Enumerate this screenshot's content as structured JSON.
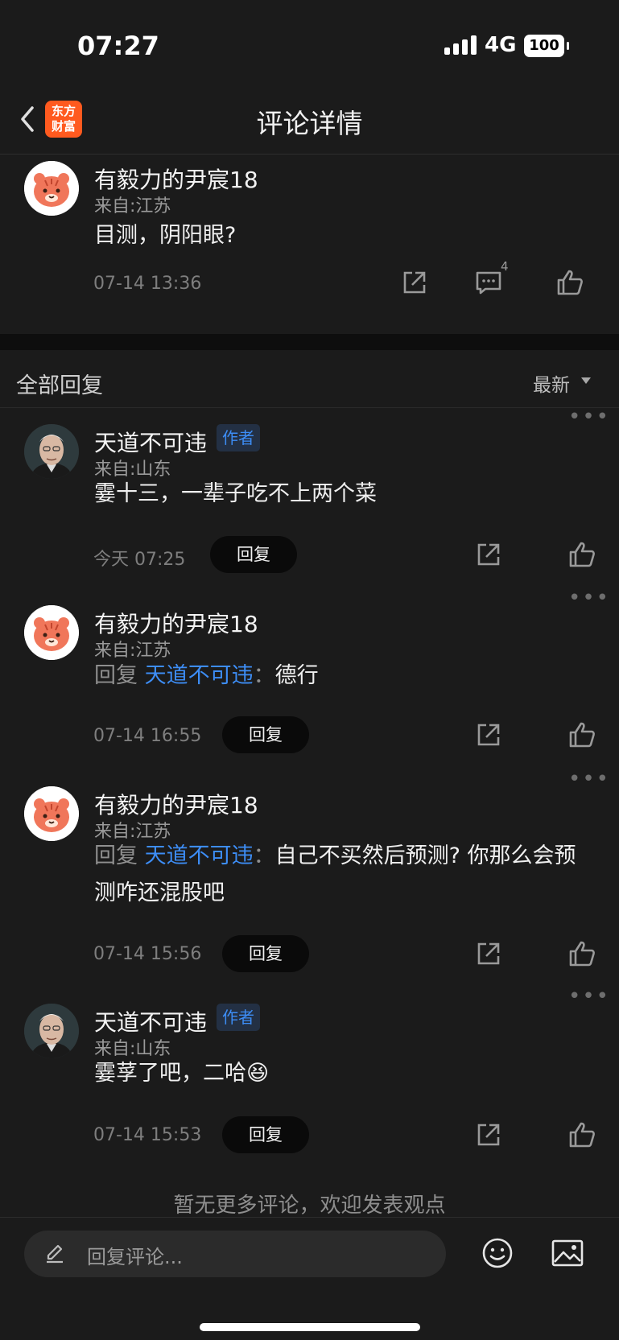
{
  "status": {
    "time": "07:27",
    "network": "4G",
    "battery": "100"
  },
  "nav": {
    "logo_line1": "东方",
    "logo_line2": "财富",
    "title": "评论详情"
  },
  "main_comment": {
    "author": "有毅力的尹宸18",
    "location": "来自:江苏",
    "text": "目测，阴阳眼?",
    "timestamp": "07-14 13:36",
    "reply_count": "4"
  },
  "section": {
    "title": "全部回复",
    "sort_label": "最新"
  },
  "replies": [
    {
      "author": "天道不可违",
      "tag": "作者",
      "location": "来自:山东",
      "text": "霎十三，一辈子吃不上两个菜",
      "timestamp": "今天 07:25",
      "reply_label": "回复"
    },
    {
      "author": "有毅力的尹宸18",
      "location": "来自:江苏",
      "prefix": "回复",
      "mention": "天道不可违",
      "separator": "：",
      "text": "德行",
      "timestamp": "07-14 16:55",
      "reply_label": "回复"
    },
    {
      "author": "有毅力的尹宸18",
      "location": "来自:江苏",
      "prefix": "回复",
      "mention": "天道不可违",
      "separator": "：",
      "text": "自己不买然后预测? 你那么会预测咋还混股吧",
      "timestamp": "07-14 15:56",
      "reply_label": "回复"
    },
    {
      "author": "天道不可违",
      "tag": "作者",
      "location": "来自:山东",
      "text": "霎莩了吧，二哈",
      "emoji": "😆",
      "timestamp": "07-14 15:53",
      "reply_label": "回复"
    }
  ],
  "end_text": "暂无更多评论，欢迎发表观点",
  "bottom": {
    "placeholder": "回复评论..."
  },
  "icons": {
    "back": "chevron-left-icon",
    "share": "share-icon",
    "comment": "comment-icon",
    "like": "thumbs-up-icon",
    "more": "more-icon",
    "pencil": "pencil-icon",
    "emoji": "emoji-icon",
    "image": "image-icon"
  },
  "colors": {
    "accent": "#3d8df5",
    "brand": "#ff5a1f",
    "background": "#1b1b1b"
  }
}
